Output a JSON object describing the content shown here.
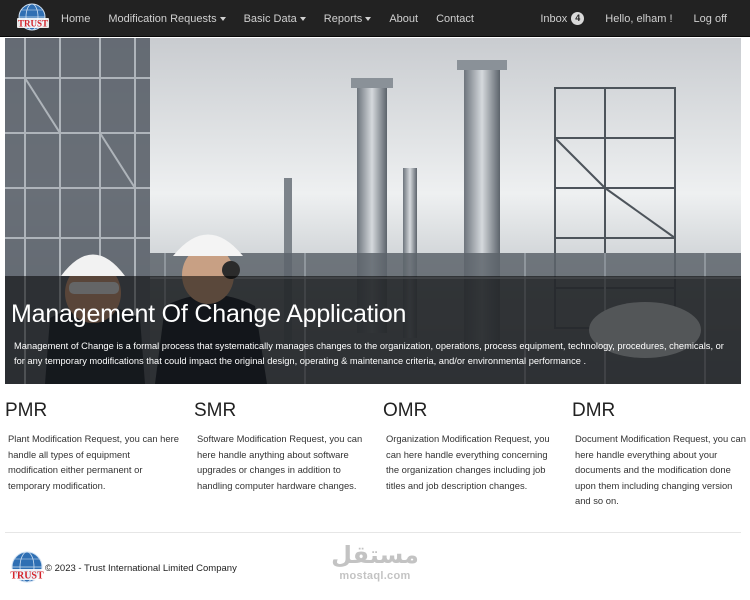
{
  "brand": {
    "logo_text": "TRUST"
  },
  "nav": {
    "items": [
      {
        "label": "Home",
        "dropdown": false
      },
      {
        "label": "Modification Requests",
        "dropdown": true
      },
      {
        "label": "Basic Data",
        "dropdown": true
      },
      {
        "label": "Reports",
        "dropdown": true
      },
      {
        "label": "About",
        "dropdown": false
      },
      {
        "label": "Contact",
        "dropdown": false
      }
    ],
    "inbox_label": "Inbox",
    "inbox_count": "4",
    "greeting": "Hello, elham !",
    "logout_label": "Log off"
  },
  "hero": {
    "title": "Management Of Change Application",
    "text": "Management of Change is a formal process that systematically manages changes to the organization, operations, process equipment, technology, procedures, chemicals, or for any temporary modifications that could impact the original design, operating & maintenance criteria, and/or environmental performance ."
  },
  "columns": [
    {
      "title": "PMR",
      "text": "Plant Modification Request, you can here handle all types of equipment modification either permanent or temporary modification."
    },
    {
      "title": "SMR",
      "text": "Software Modification Request, you can here handle anything about software upgrades or changes in addition to handling computer hardware changes."
    },
    {
      "title": "OMR",
      "text": "Organization Modification Request, you can here handle everything concerning the organization changes including job titles and job description changes."
    },
    {
      "title": "DMR",
      "text": "Document Modification Request, you can here handle everything about your documents and the modification done upon them including changing version and so on."
    }
  ],
  "footer": {
    "copyright": "© 2023 - Trust International Limited Company"
  },
  "watermark": {
    "arabic": "مستقل",
    "latin": "mostaql.com"
  },
  "colors": {
    "navbar": "#222222",
    "nav_text": "#d0d0d0",
    "logo_globe": "#2f6fb3",
    "logo_text": "#d4242b",
    "hero_overlay": "rgba(0,0,0,0.55)"
  }
}
